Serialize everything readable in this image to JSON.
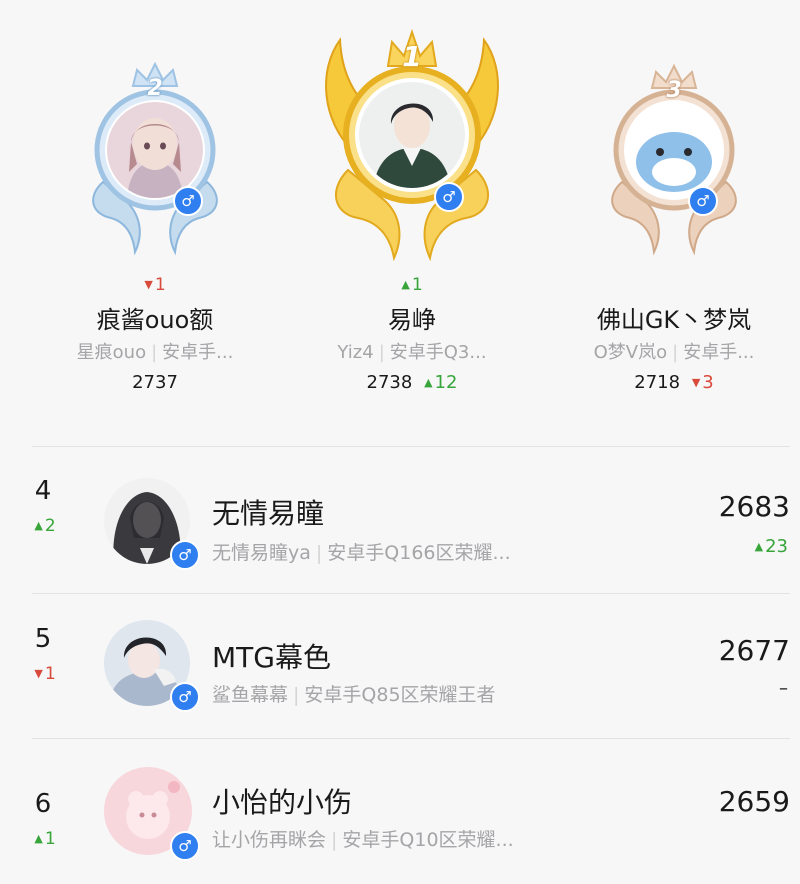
{
  "podium": [
    {
      "rank": "2",
      "change": "1",
      "change_dir": "down",
      "name": "痕酱ouo额",
      "nickname": "星痕ouo",
      "server": "安卓手...",
      "score": "2737",
      "score_change": "",
      "frame_color": "#a9c9e6",
      "gender": "♂"
    },
    {
      "rank": "1",
      "change": "1",
      "change_dir": "up",
      "name": "易峥",
      "nickname": "Yiz4",
      "server": "安卓手Q3...",
      "score": "2738",
      "score_change": "12",
      "score_change_dir": "up",
      "frame_color": "#f3c535",
      "gender": "♂"
    },
    {
      "rank": "3",
      "change": "",
      "change_dir": "",
      "name": "佛山GK丶梦岚",
      "nickname": "O梦V岚o",
      "server": "安卓手...",
      "score": "2718",
      "score_change": "3",
      "score_change_dir": "down",
      "frame_color": "#e3c3a8",
      "gender": "♂"
    }
  ],
  "rows": [
    {
      "rank": "4",
      "change": "2",
      "change_dir": "up",
      "name": "无情易瞳",
      "nickname": "无情易瞳ya",
      "server": "安卓手Q166区荣耀...",
      "score": "2683",
      "score_change": "23",
      "score_change_dir": "up",
      "gender": "♂"
    },
    {
      "rank": "5",
      "change": "1",
      "change_dir": "down",
      "name": "MTG幕色",
      "nickname": "鲨鱼幕幕",
      "server": "安卓手Q85区荣耀王者",
      "score": "2677",
      "score_change": "–",
      "score_change_dir": "none",
      "gender": "♂"
    },
    {
      "rank": "6",
      "change": "1",
      "change_dir": "up",
      "name": "小怡的小伤",
      "nickname": "让小伤再眯会",
      "server": "安卓手Q10区荣耀...",
      "score": "2659",
      "score_change": "",
      "score_change_dir": "none",
      "gender": "♂"
    }
  ],
  "colors": {
    "up": "#38a53a",
    "down": "#d94a3a",
    "gender_badge": "#2f7ff0"
  }
}
